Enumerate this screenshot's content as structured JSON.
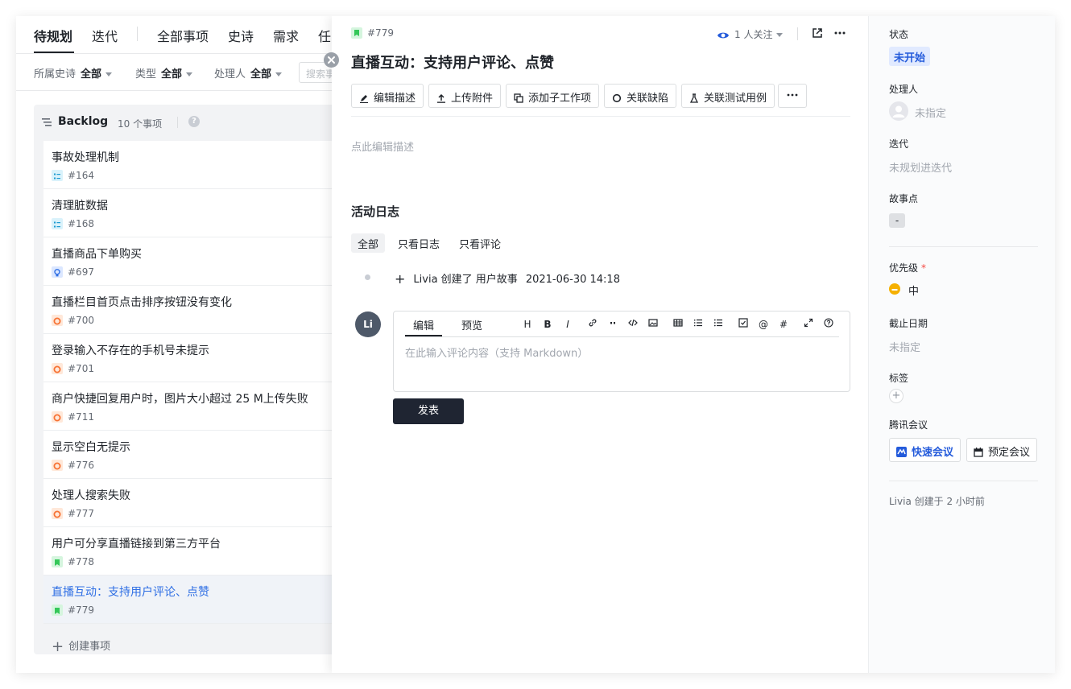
{
  "left": {
    "tabs": [
      "待规划",
      "迭代",
      "全部事项",
      "史诗",
      "需求",
      "任"
    ],
    "filters": {
      "epic_label": "所属史诗",
      "epic_value": "全部",
      "type_label": "类型",
      "type_value": "全部",
      "assignee_label": "处理人",
      "assignee_value": "全部",
      "search_placeholder": "搜索事"
    },
    "board": {
      "title": "Backlog",
      "count": "10 个事项",
      "help": "?",
      "items": [
        {
          "title": "事故处理机制",
          "id": "#164",
          "type": "task"
        },
        {
          "title": "清理脏数据",
          "id": "#168",
          "type": "task"
        },
        {
          "title": "直播商品下单购买",
          "id": "#697",
          "type": "idea"
        },
        {
          "title": "直播栏目首页点击排序按钮没有变化",
          "id": "#700",
          "type": "bug"
        },
        {
          "title": "登录输入不存在的手机号未提示",
          "id": "#701",
          "type": "bug"
        },
        {
          "title": "商户快捷回复用户时，图片大小超过 25 M上传失败",
          "id": "#711",
          "type": "bug"
        },
        {
          "title": "显示空白无提示",
          "id": "#776",
          "type": "bug"
        },
        {
          "title": "处理人搜索失败",
          "id": "#777",
          "type": "bug"
        },
        {
          "title": "用户可分享直播链接到第三方平台",
          "id": "#778",
          "type": "story"
        },
        {
          "title": "直播互动：支持用户评论、点赞",
          "id": "#779",
          "type": "story"
        }
      ],
      "create_label": "创建事项"
    }
  },
  "detail": {
    "id": "#779",
    "follow": "1 人关注",
    "title": "直播互动：支持用户评论、点赞",
    "actions": [
      "编辑描述",
      "上传附件",
      "添加子工作项",
      "关联缺陷",
      "关联测试用例"
    ],
    "desc_placeholder": "点此编辑描述",
    "log": {
      "title": "活动日志",
      "tabs": [
        "全部",
        "只看日志",
        "只看评论"
      ],
      "entry_text": "Livia 创建了 用户故事",
      "entry_time": "2021-06-30 14:18"
    },
    "comment": {
      "avatar": "Li",
      "tabs": [
        "编辑",
        "预览"
      ],
      "toolbar": [
        "H",
        "B",
        "I",
        "link-icon",
        "quote-icon",
        "code-icon",
        "image-icon",
        "table-icon",
        "ordered-list-icon",
        "bullet-list-icon",
        "checkbox-icon",
        "@",
        "#",
        "expand-icon",
        "help-icon"
      ],
      "placeholder": "在此输入评论内容（支持 Markdown）",
      "publish": "发表"
    },
    "side": {
      "status_label": "状态",
      "status_value": "未开始",
      "assignee_label": "处理人",
      "assignee_value": "未指定",
      "iteration_label": "迭代",
      "iteration_value": "未规划进迭代",
      "points_label": "故事点",
      "points_value": "-",
      "priority_label": "优先级",
      "priority_required": "*",
      "priority_value": "中",
      "due_label": "截止日期",
      "due_value": "未指定",
      "tags_label": "标签",
      "tags_add": "+",
      "meeting_label": "腾讯会议",
      "quick_meeting": "快速会议",
      "book_meeting": "预定会议",
      "created": "Livia 创建于 2 小时前"
    },
    "colors": {
      "accent": "#245bdb",
      "status_bg": "#e1eaff",
      "priority": "#f5b000",
      "publish_bg": "#1f2532"
    }
  }
}
